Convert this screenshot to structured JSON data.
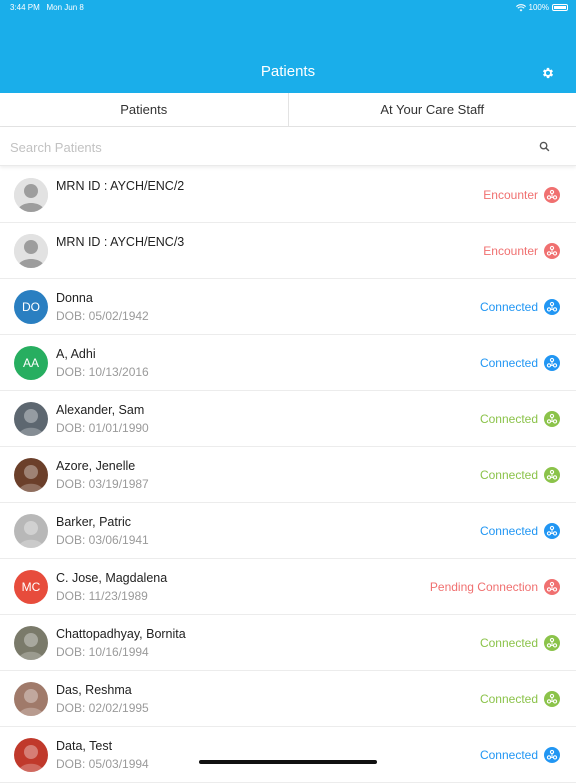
{
  "status_bar": {
    "time": "3:44 PM",
    "date": "Mon Jun 8",
    "battery": "100%"
  },
  "header": {
    "title": "Patients"
  },
  "tabs": [
    {
      "label": "Patients"
    },
    {
      "label": "At Your Care Staff"
    }
  ],
  "search": {
    "placeholder": "Search Patients",
    "value": ""
  },
  "colors": {
    "brand": "#1aaeea",
    "encounter": "#f07070",
    "connected_blue": "#2196f3",
    "connected_green": "#8bc34a",
    "pending": "#f07070"
  },
  "patients": [
    {
      "name": "MRN ID : AYCH/ENC/2",
      "dob": "",
      "status": "Encounter",
      "status_color": "#f07070",
      "avatar": {
        "type": "placeholder",
        "initials": ""
      }
    },
    {
      "name": "MRN ID : AYCH/ENC/3",
      "dob": "",
      "status": "Encounter",
      "status_color": "#f07070",
      "avatar": {
        "type": "placeholder",
        "initials": ""
      }
    },
    {
      "name": "Donna",
      "dob": "DOB: 05/02/1942",
      "status": "Connected",
      "status_color": "#2196f3",
      "avatar": {
        "type": "initials",
        "initials": "DO",
        "color": "#2a7fc1"
      }
    },
    {
      "name": "A, Adhi",
      "dob": "DOB: 10/13/2016",
      "status": "Connected",
      "status_color": "#2196f3",
      "avatar": {
        "type": "initials",
        "initials": "AA",
        "color": "#27ae60"
      }
    },
    {
      "name": "Alexander, Sam",
      "dob": "DOB: 01/01/1990",
      "status": "Connected",
      "status_color": "#8bc34a",
      "avatar": {
        "type": "photo",
        "initials": "",
        "color": "#5d6770"
      }
    },
    {
      "name": "Azore, Jenelle",
      "dob": "DOB: 03/19/1987",
      "status": "Connected",
      "status_color": "#8bc34a",
      "avatar": {
        "type": "photo",
        "initials": "",
        "color": "#6b3f2a"
      }
    },
    {
      "name": "Barker, Patric",
      "dob": "DOB: 03/06/1941",
      "status": "Connected",
      "status_color": "#2196f3",
      "avatar": {
        "type": "photo",
        "initials": "",
        "color": "#b8b8b8"
      }
    },
    {
      "name": "C. Jose, Magdalena",
      "dob": "DOB: 11/23/1989",
      "status": "Pending Connection",
      "status_color": "#f07070",
      "avatar": {
        "type": "initials",
        "initials": "MC",
        "color": "#e74c3c"
      }
    },
    {
      "name": "Chattopadhyay, Bornita",
      "dob": "DOB: 10/16/1994",
      "status": "Connected",
      "status_color": "#8bc34a",
      "avatar": {
        "type": "photo",
        "initials": "",
        "color": "#7a7a6a"
      }
    },
    {
      "name": "Das, Reshma",
      "dob": "DOB: 02/02/1995",
      "status": "Connected",
      "status_color": "#8bc34a",
      "avatar": {
        "type": "photo",
        "initials": "",
        "color": "#a07a6a"
      }
    },
    {
      "name": "Data, Test",
      "dob": "DOB: 05/03/1994",
      "status": "Connected",
      "status_color": "#2196f3",
      "avatar": {
        "type": "photo",
        "initials": "",
        "color": "#c0392b"
      }
    }
  ]
}
